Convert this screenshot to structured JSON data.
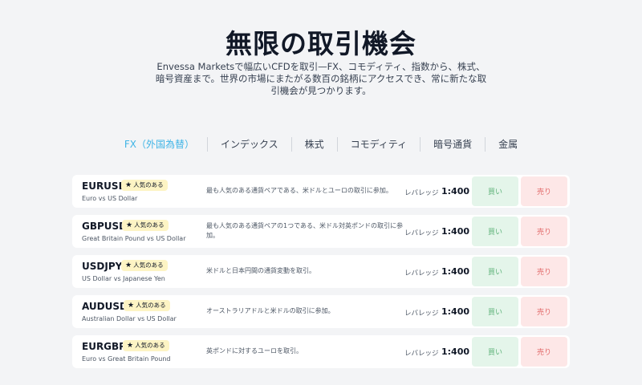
{
  "header": {
    "title": "無限の取引機会",
    "subtitle": "Envessa Marketsで幅広いCFDを取引—FX、コモディティ、指数から、株式、暗号資産まで。世界の市場にまたがる数百の銘柄にアクセスでき、常に新たな取引機会が見つかります。"
  },
  "tabs": [
    {
      "label": "FX（外国為替）",
      "active": true
    },
    {
      "label": "インデックス",
      "active": false
    },
    {
      "label": "株式",
      "active": false
    },
    {
      "label": "コモディティ",
      "active": false
    },
    {
      "label": "暗号通貨",
      "active": false
    },
    {
      "label": "金属",
      "active": false
    }
  ],
  "instruments": [
    {
      "symbol": "EURUSD",
      "badge": "人気のある",
      "pair": "Euro vs US Dollar",
      "description": "最も人気のある通貨ペアである、米ドルとユーロの取引に参加。",
      "leverage_label": "レバレッジ",
      "leverage": "1:400",
      "buy_label": "買い",
      "sell_label": "売り"
    },
    {
      "symbol": "GBPUSD",
      "badge": "人気のある",
      "pair": "Great Britain Pound vs US Dollar",
      "description": "最も人気のある通貨ペアの1つである、米ドル対英ポンドの取引に参加。",
      "leverage_label": "レバレッジ",
      "leverage": "1:400",
      "buy_label": "買い",
      "sell_label": "売り"
    },
    {
      "symbol": "USDJPY",
      "badge": "人気のある",
      "pair": "US Dollar vs Japanese Yen",
      "description": "米ドルと日本円間の通貨変動を取引。",
      "leverage_label": "レバレッジ",
      "leverage": "1:400",
      "buy_label": "買い",
      "sell_label": "売り"
    },
    {
      "symbol": "AUDUSD",
      "badge": "人気のある",
      "pair": "Australian Dollar vs US Dollar",
      "description": "オーストラリアドルと米ドルの取引に参加。",
      "leverage_label": "レバレッジ",
      "leverage": "1:400",
      "buy_label": "買い",
      "sell_label": "売り"
    },
    {
      "symbol": "EURGBP",
      "badge": "人気のある",
      "pair": "Euro vs Great Britain Pound",
      "description": "英ポンドに対するユーロを取引。",
      "leverage_label": "レバレッジ",
      "leverage": "1:400",
      "buy_label": "買い",
      "sell_label": "売り"
    }
  ],
  "colors": {
    "active_tab": "#3fb4e6",
    "buy_bg": "#e4f5ea",
    "buy_text": "#5fb37a",
    "sell_bg": "#fde7e7",
    "sell_text": "#e26b6b",
    "badge_bg": "#fdf4c4"
  },
  "icons": {
    "badge_icon": "star-icon"
  }
}
